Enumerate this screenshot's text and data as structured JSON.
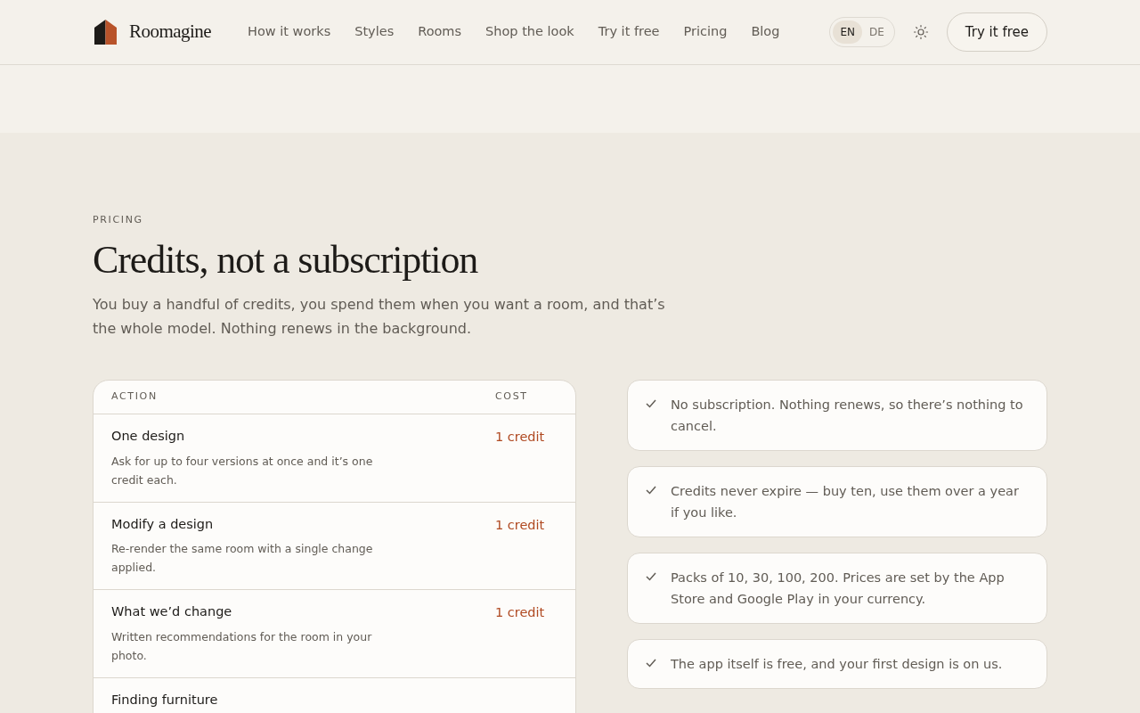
{
  "brand": {
    "name": "Roomagine"
  },
  "nav": [
    "How it works",
    "Styles",
    "Rooms",
    "Shop the look",
    "Try it free",
    "Pricing",
    "Blog"
  ],
  "languages": [
    {
      "label": "EN",
      "selected": true
    },
    {
      "label": "DE",
      "selected": false
    }
  ],
  "cta": "Try it free",
  "section": {
    "eyebrow": "PRICING",
    "title": "Credits, not a subscription",
    "lead": "You buy a handful of credits, you spend them when you want a room, and that’s the whole model. Nothing renews in the background."
  },
  "table": {
    "columns": [
      "ACTION",
      "COST"
    ],
    "rows": [
      {
        "title": "One design",
        "description": "Ask for up to four versions at once and it’s one credit each.",
        "cost": "1 credit"
      },
      {
        "title": "Modify a design",
        "description": "Re-render the same room with a single change applied.",
        "cost": "1 credit"
      },
      {
        "title": "What we’d change",
        "description": "Written recommendations for the room in your photo.",
        "cost": "1 credit"
      },
      {
        "title": "Finding furniture"
      }
    ]
  },
  "facts": [
    "No subscription. Nothing renews, so there’s nothing to cancel.",
    "Credits never expire — buy ten, use them over a year if you like.",
    "Packs of 10, 30, 100, 200. Prices are set by the App Store and Google Play in your currency.",
    "The app itself is free, and your first design is on us."
  ]
}
